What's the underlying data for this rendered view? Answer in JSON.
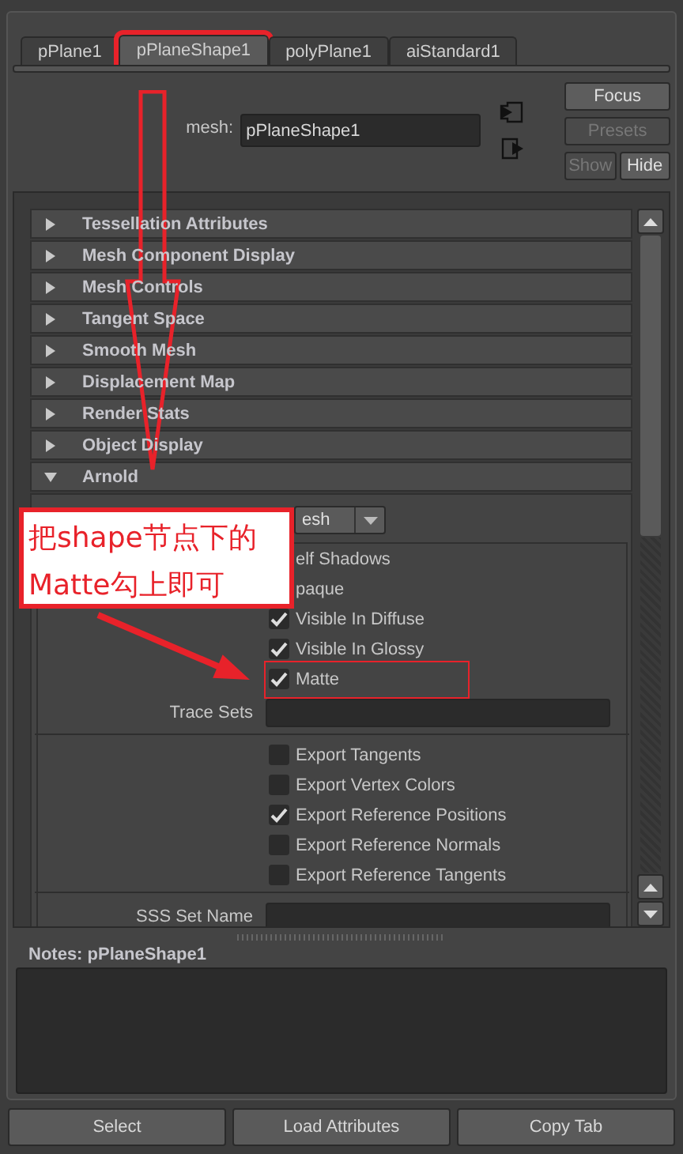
{
  "tabs": [
    {
      "label": "pPlane1",
      "selected": false,
      "highlighted": false
    },
    {
      "label": "pPlaneShape1",
      "selected": true,
      "highlighted": true
    },
    {
      "label": "polyPlane1",
      "selected": false,
      "highlighted": false
    },
    {
      "label": "aiStandard1",
      "selected": false,
      "highlighted": false
    }
  ],
  "header": {
    "label": "mesh:",
    "value": "pPlaneShape1",
    "buttons": [
      {
        "label": "Focus",
        "disabled": false
      },
      {
        "label": "Presets",
        "disabled": true
      },
      {
        "label": "Show",
        "disabled": true
      },
      {
        "label": "Hide",
        "disabled": false
      }
    ]
  },
  "sections": [
    {
      "title": "Tessellation Attributes",
      "expanded": false
    },
    {
      "title": "Mesh Component Display",
      "expanded": false
    },
    {
      "title": "Mesh Controls",
      "expanded": false
    },
    {
      "title": "Tangent Space",
      "expanded": false
    },
    {
      "title": "Smooth Mesh",
      "expanded": false
    },
    {
      "title": "Displacement Map",
      "expanded": false
    },
    {
      "title": "Render Stats",
      "expanded": false
    },
    {
      "title": "Object Display",
      "expanded": false
    },
    {
      "title": "Arnold",
      "expanded": true
    }
  ],
  "arnold": {
    "dropdown": "esh",
    "checks": [
      {
        "label": "elf Shadows",
        "highlighted": false
      },
      {
        "label": "paque",
        "highlighted": false
      },
      {
        "label": "Visible In Diffuse",
        "checked": true,
        "highlighted": false
      },
      {
        "label": "Visible In Glossy",
        "checked": true,
        "highlighted": false
      },
      {
        "label": "Matte",
        "checked": true,
        "highlighted": true
      }
    ],
    "trace_sets": "Trace Sets",
    "exports": [
      {
        "label": "Export Tangents",
        "checked": false
      },
      {
        "label": "Export Vertex Colors",
        "checked": false
      },
      {
        "label": "Export Reference Positions",
        "checked": true
      },
      {
        "label": "Export Reference Normals",
        "checked": false
      },
      {
        "label": "Export Reference Tangents",
        "checked": false
      }
    ],
    "sss_set_name": "SSS Set Name"
  },
  "notes": {
    "label": "Notes:  pPlaneShape1"
  },
  "buttons": [
    "Select",
    "Load Attributes",
    "Copy Tab"
  ],
  "annotation": {
    "text": "把shape节点下的\nMatte勾上即可"
  }
}
